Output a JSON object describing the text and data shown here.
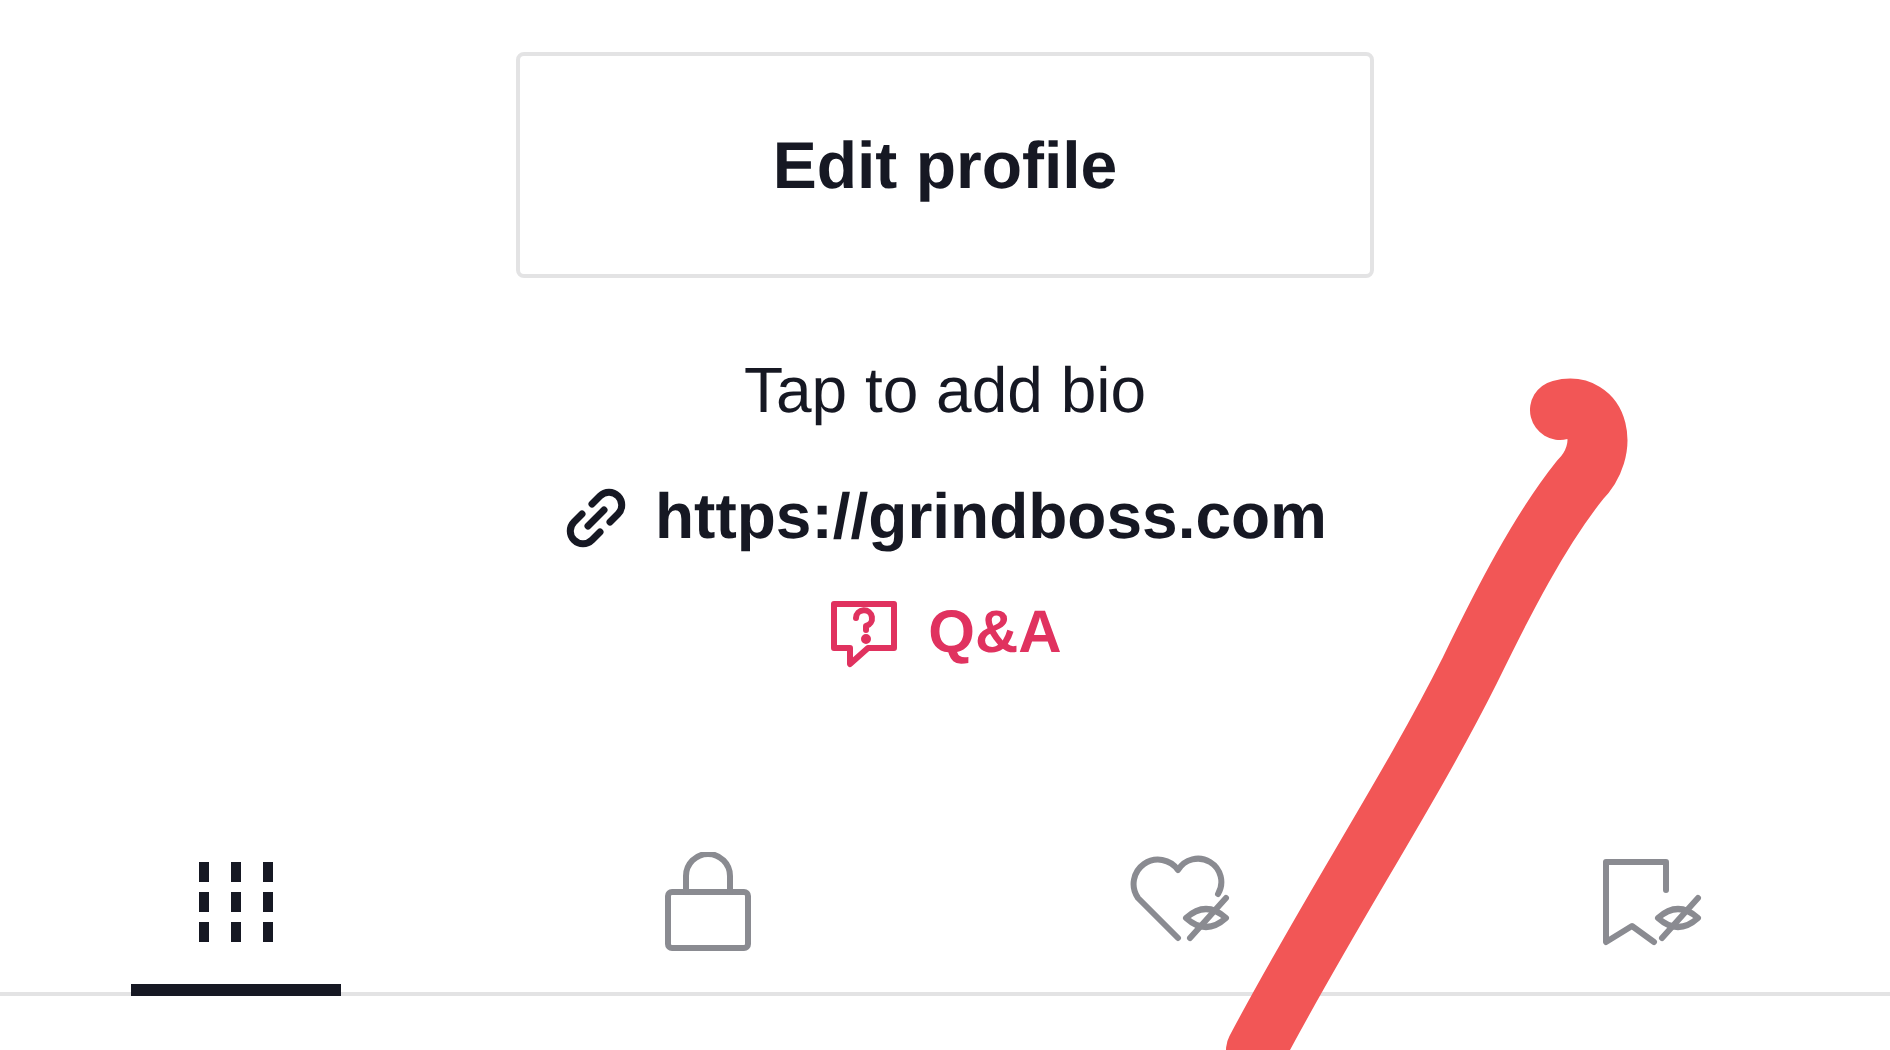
{
  "edit_button": {
    "label": "Edit profile"
  },
  "bio": "Tap to add bio",
  "link": "https://grindboss.com",
  "qa": {
    "label": "Q&A"
  },
  "tabs": [
    {
      "kind": "videos",
      "selected": true
    },
    {
      "kind": "private",
      "selected": false
    },
    {
      "kind": "liked",
      "selected": false
    },
    {
      "kind": "saved",
      "selected": false
    }
  ]
}
